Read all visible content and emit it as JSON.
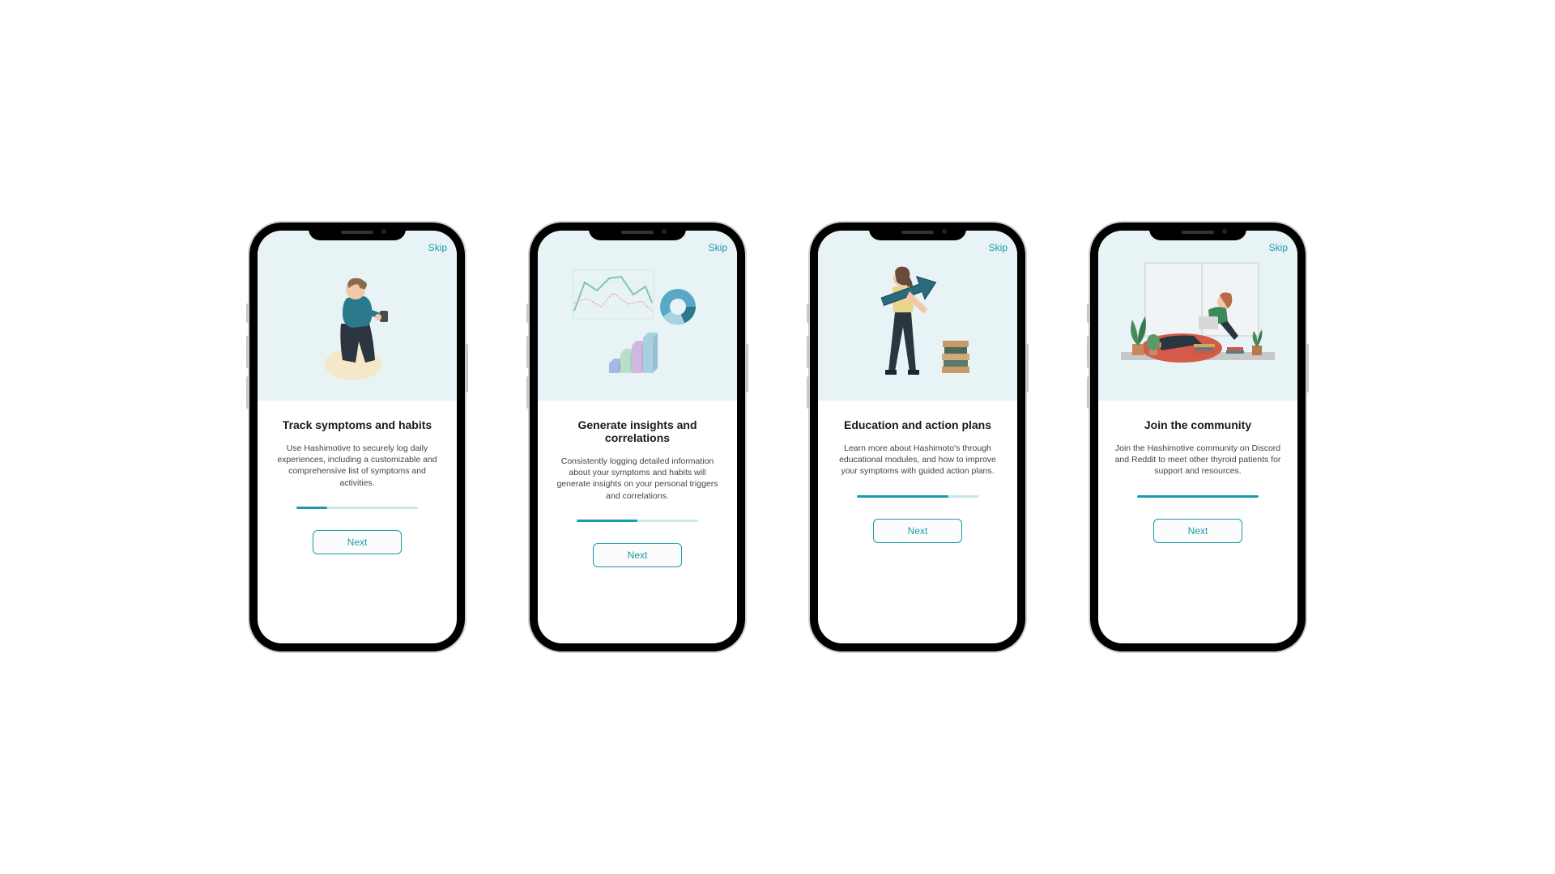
{
  "screens": [
    {
      "skip_label": "Skip",
      "title": "Track symptoms and habits",
      "description": "Use Hashimotive to securely log daily experiences, including a customizable and comprehensive list of symptoms and activities.",
      "next_label": "Next",
      "progress_percent": 25,
      "illustration": "woman-using-phone"
    },
    {
      "skip_label": "Skip",
      "title": "Generate insights and correlations",
      "description": "Consistently logging detailed information about your symptoms and habits will generate insights on your personal triggers and correlations.",
      "next_label": "Next",
      "progress_percent": 50,
      "illustration": "charts-and-graphs"
    },
    {
      "skip_label": "Skip",
      "title": "Education and action plans",
      "description": "Learn more about Hashimoto's through educational modules, and how to improve your symptoms with guided action plans.",
      "next_label": "Next",
      "progress_percent": 75,
      "illustration": "woman-with-arrow-and-books"
    },
    {
      "skip_label": "Skip",
      "title": "Join the community",
      "description": "Join the Hashimotive community  on Discord and Reddit to meet other thyroid patients for support and resources.",
      "next_label": "Next",
      "progress_percent": 100,
      "illustration": "woman-on-laptop-with-plants"
    }
  ],
  "colors": {
    "accent": "#1a9ba8",
    "hero_bg": "#e8f3f6",
    "progress_bg": "#c9e8ec"
  }
}
